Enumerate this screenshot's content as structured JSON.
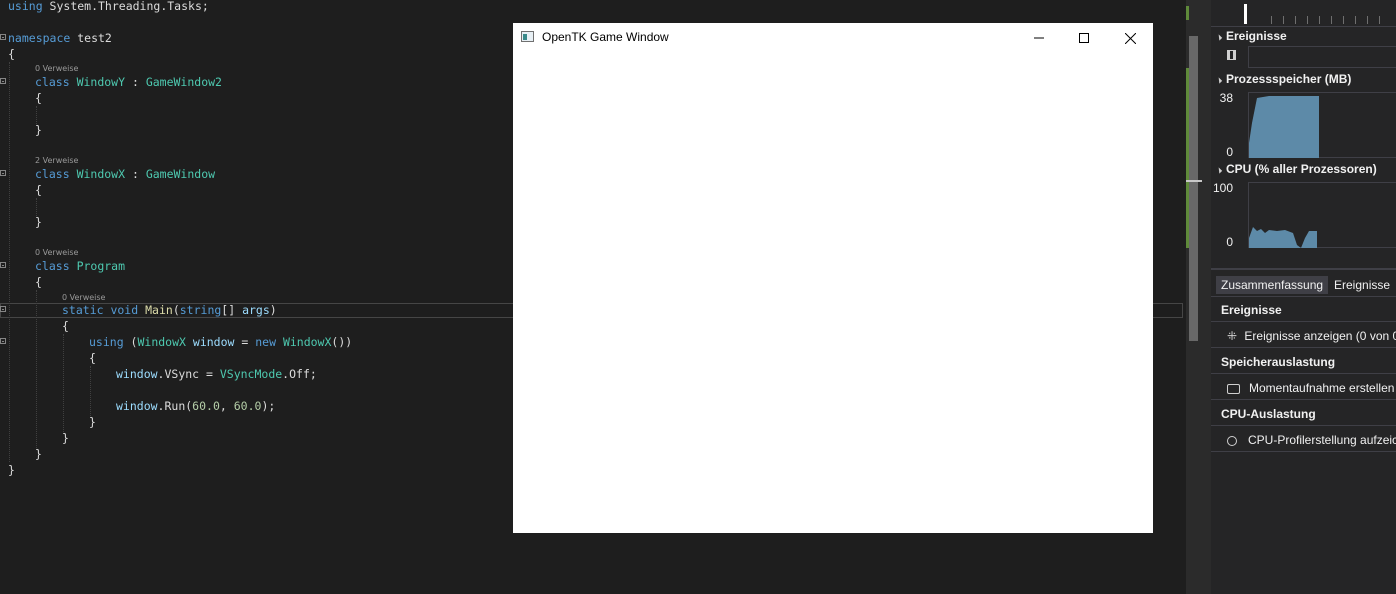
{
  "editor": {
    "lines": {
      "using_kw": "using",
      "using_ns": " System.Threading.Tasks;",
      "namespace_kw": "namespace",
      "namespace_name": " test2",
      "brace_open": "{",
      "brace_close": "}",
      "lens_windowy": "0 Verweise",
      "class_kw": "class",
      "windowy_name": "WindowY",
      "colon": " : ",
      "windowy_base": "GameWindow2",
      "lens_windowx": "2 Verweise",
      "windowx_name": "WindowX",
      "windowx_base": "GameWindow",
      "lens_program": "0 Verweise",
      "program_name": "Program",
      "lens_main": "0 Verweise",
      "static_void": "static void",
      "main_name": "Main",
      "main_params_open": "(",
      "string_kw": "string",
      "main_params_rest": "[] ",
      "args": "args",
      "main_params_close": ")",
      "using_stmt_kw": "using",
      "using_paren": " (",
      "using_type": "WindowX",
      "using_var": "window",
      "using_eq": " = ",
      "new_kw": "new",
      "using_ctor": "WindowX",
      "using_end": "())",
      "vsync_obj": "window",
      "vsync_prop": ".VSync = ",
      "vsync_enum": "VSyncMode",
      "vsync_val": ".Off;",
      "run_obj": "window",
      "run_call": ".Run(",
      "run_a1": "60.0",
      "run_comma": ", ",
      "run_a2": "60.0",
      "run_end": ");"
    }
  },
  "game_window": {
    "title": "OpenTK Game Window",
    "minimize_icon": "minimize-icon",
    "maximize_icon": "maximize-icon",
    "close_icon": "close-icon"
  },
  "diagnostics": {
    "events_section": "Ereignisse",
    "memory_section": "Prozessspeicher (MB)",
    "memory_max": "38",
    "memory_min": "0",
    "cpu_section": "CPU (% aller Prozessoren)",
    "cpu_max": "100",
    "cpu_min": "0",
    "tab_summary": "Zusammenfassung",
    "tab_events": "Ereignisse",
    "hdr_events": "Ereignisse",
    "show_events": "Ereignisse anzeigen (0 von 0",
    "hdr_memory": "Speicherauslastung",
    "snapshot": "Momentaufnahme erstellen",
    "hdr_cpu": "CPU-Auslastung",
    "cpu_profiling": "CPU-Profilerstellung aufzeic",
    "colors": {
      "chart_fill": "#5d8aa8",
      "accent": "#007acc"
    }
  }
}
